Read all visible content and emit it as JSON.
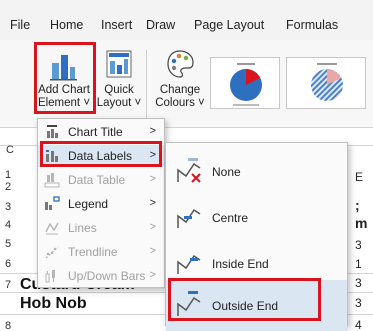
{
  "ribbon_tabs": [
    "File",
    "Home",
    "Insert",
    "Draw",
    "Page Layout",
    "Formulas"
  ],
  "ribbon_buttons": {
    "add_chart_element": [
      "Add Chart",
      "Element ˅"
    ],
    "quick_layout": [
      "Quick",
      "Layout ˅"
    ],
    "change_colours": [
      "Change",
      "Colours ˅"
    ]
  },
  "grid": {
    "row_numbers": [
      "1",
      "2",
      "3",
      "4",
      "5",
      "6",
      "7",
      "8"
    ],
    "bold_cells": [
      "Custard Cream",
      "Hob Nob"
    ],
    "right_edge_fragments": [
      "E",
      ";",
      "m",
      "3",
      "1",
      "3",
      "3",
      "4"
    ]
  },
  "menu": {
    "items": [
      {
        "label": "Chart Title",
        "enabled": true,
        "has_submenu": true,
        "icon": "chart-title-icon"
      },
      {
        "label": "Data Labels",
        "enabled": true,
        "has_submenu": true,
        "icon": "data-labels-icon"
      },
      {
        "label": "Data Table",
        "enabled": false,
        "has_submenu": true,
        "icon": "data-table-icon"
      },
      {
        "label": "Legend",
        "enabled": true,
        "has_submenu": true,
        "icon": "legend-icon"
      },
      {
        "label": "Lines",
        "enabled": false,
        "has_submenu": true,
        "icon": "lines-icon"
      },
      {
        "label": "Trendline",
        "enabled": false,
        "has_submenu": true,
        "icon": "trendline-icon"
      },
      {
        "label": "Up/Down Bars",
        "enabled": false,
        "has_submenu": true,
        "icon": "up-down-bars-icon"
      }
    ]
  },
  "submenu": {
    "items": [
      {
        "label": "None",
        "icon": "no-labels-icon"
      },
      {
        "label": "Centre",
        "icon": "centre-labels-icon"
      },
      {
        "label": "Inside End",
        "icon": "inside-end-labels-icon"
      },
      {
        "label": "Outside End",
        "icon": "outside-end-labels-icon"
      }
    ]
  },
  "colors": {
    "highlight": "#d9141c",
    "accent_blue": "#2f6fbf",
    "hover": "#dbe6f3"
  }
}
